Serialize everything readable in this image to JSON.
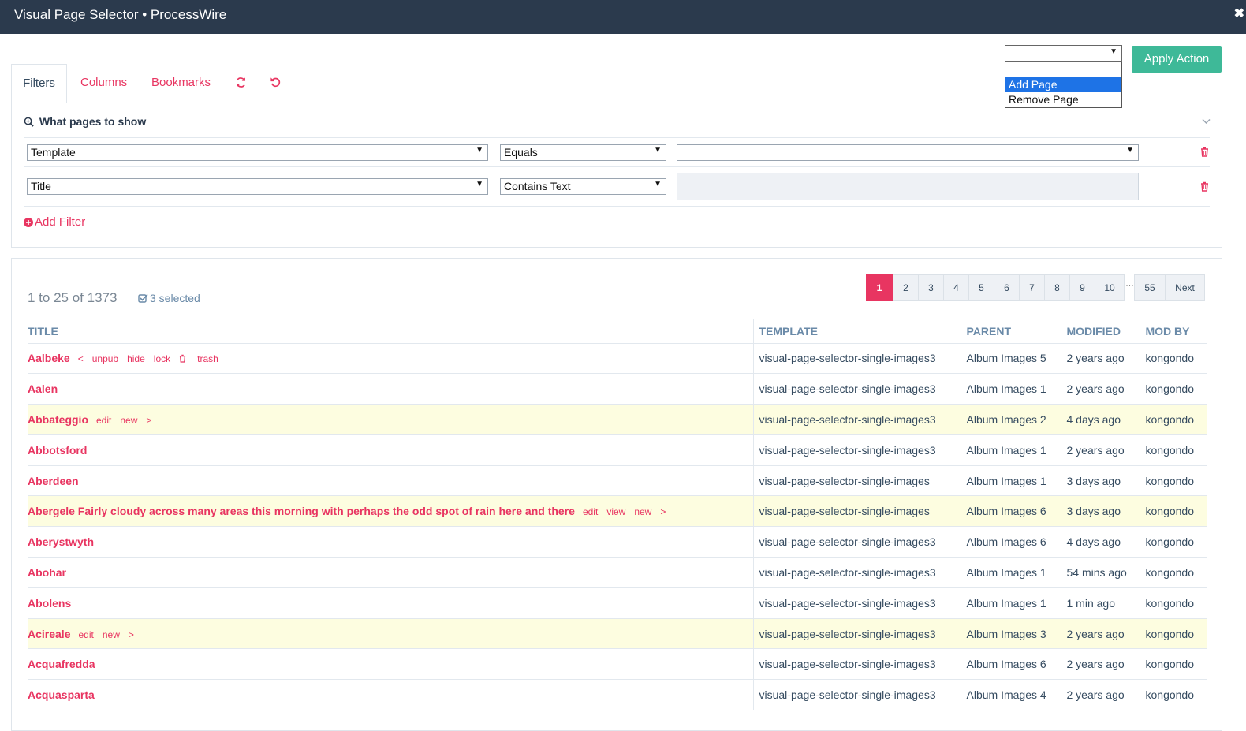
{
  "window": {
    "title": "Visual Page Selector • ProcessWire",
    "close_glyph": "✖"
  },
  "tabs": [
    {
      "label": "Filters"
    },
    {
      "label": "Columns"
    },
    {
      "label": "Bookmarks"
    }
  ],
  "icons": {
    "refresh": "refresh-icon",
    "reset": "reset-icon"
  },
  "actions": {
    "selected_value": "",
    "options": [
      "Add Page",
      "Remove Page"
    ],
    "highlighted": "Add Page",
    "apply_label": "Apply Action"
  },
  "filters": {
    "heading": "What pages to show",
    "rows": [
      {
        "field": "Template",
        "operator": "Equals",
        "value": ""
      },
      {
        "field": "Title",
        "operator": "Contains Text",
        "value": ""
      }
    ],
    "add_label": "Add Filter"
  },
  "results": {
    "count_text": "1 to 25 of 1373",
    "selected_text": "3 selected",
    "pagination": [
      "1",
      "2",
      "3",
      "4",
      "5",
      "6",
      "7",
      "8",
      "9",
      "10",
      "55"
    ],
    "current_page": "1",
    "ellipsis": "…",
    "next_label": "Next",
    "columns": [
      "TITLE",
      "TEMPLATE",
      "PARENT",
      "MODIFIED",
      "MOD BY"
    ],
    "rows": [
      {
        "title": "Aalbeke",
        "actions": [
          "<",
          "unpub",
          "hide",
          "lock",
          "trash"
        ],
        "template": "visual-page-selector-single-images3",
        "parent": "Album Images 5",
        "modified": "2 years ago",
        "mod_by": "kongondo"
      },
      {
        "title": "Aalen",
        "actions": [],
        "template": "visual-page-selector-single-images3",
        "parent": "Album Images 1",
        "modified": "2 years ago",
        "mod_by": "kongondo"
      },
      {
        "title": "Abbateggio",
        "actions": [
          "edit",
          "new",
          ">"
        ],
        "template": "visual-page-selector-single-images3",
        "parent": "Album Images 2",
        "modified": "4 days ago",
        "mod_by": "kongondo",
        "highlight": true
      },
      {
        "title": "Abbotsford",
        "actions": [],
        "template": "visual-page-selector-single-images3",
        "parent": "Album Images 1",
        "modified": "2 years ago",
        "mod_by": "kongondo"
      },
      {
        "title": "Aberdeen",
        "actions": [],
        "template": "visual-page-selector-single-images",
        "parent": "Album Images 1",
        "modified": "3 days ago",
        "mod_by": "kongondo"
      },
      {
        "title": "Abergele Fairly cloudy across many areas this morning with perhaps the odd spot of rain here and there",
        "actions": [
          "edit",
          "view",
          "new",
          ">"
        ],
        "template": "visual-page-selector-single-images",
        "parent": "Album Images 6",
        "modified": "3 days ago",
        "mod_by": "kongondo",
        "highlight": true
      },
      {
        "title": "Aberystwyth",
        "actions": [],
        "template": "visual-page-selector-single-images3",
        "parent": "Album Images 6",
        "modified": "4 days ago",
        "mod_by": "kongondo"
      },
      {
        "title": "Abohar",
        "actions": [],
        "template": "visual-page-selector-single-images3",
        "parent": "Album Images 1",
        "modified": "54 mins ago",
        "mod_by": "kongondo"
      },
      {
        "title": "Abolens",
        "actions": [],
        "template": "visual-page-selector-single-images3",
        "parent": "Album Images 1",
        "modified": "1 min ago",
        "mod_by": "kongondo"
      },
      {
        "title": "Acireale",
        "actions": [
          "edit",
          "new",
          ">"
        ],
        "template": "visual-page-selector-single-images3",
        "parent": "Album Images 3",
        "modified": "2 years ago",
        "mod_by": "kongondo",
        "highlight": true
      },
      {
        "title": "Acquafredda",
        "actions": [],
        "template": "visual-page-selector-single-images3",
        "parent": "Album Images 6",
        "modified": "2 years ago",
        "mod_by": "kongondo"
      },
      {
        "title": "Acquasparta",
        "actions": [],
        "template": "visual-page-selector-single-images3",
        "parent": "Album Images 4",
        "modified": "2 years ago",
        "mod_by": "kongondo"
      }
    ]
  },
  "colors": {
    "accent": "#e83561",
    "header_bg": "#2b3a4d",
    "apply_green": "#3eb998",
    "row_highlight": "#fdfde0"
  }
}
